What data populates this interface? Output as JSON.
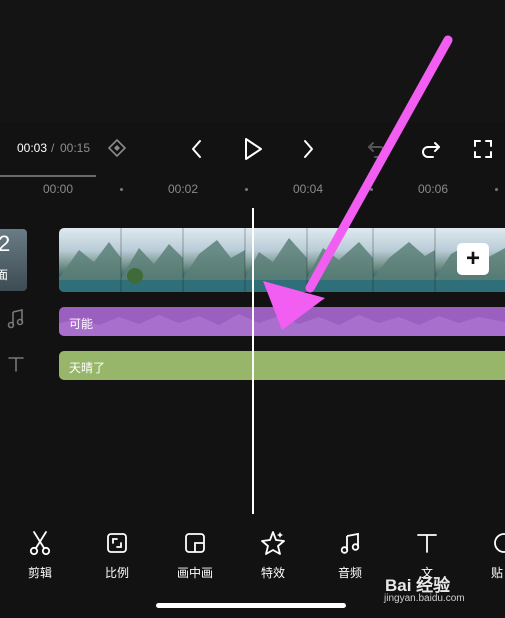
{
  "playback": {
    "current_time": "00:03",
    "separator": "/",
    "total_time": "00:15"
  },
  "ruler": {
    "ticks": [
      "00:00",
      "00:02",
      "00:04",
      "00:06"
    ]
  },
  "cover": {
    "number": "2",
    "label": "面"
  },
  "tracks": {
    "audio_label": "可能",
    "text_label": "天晴了"
  },
  "toolbar": {
    "items": [
      {
        "label": "剪辑",
        "icon": "scissors-icon"
      },
      {
        "label": "比例",
        "icon": "ratio-icon"
      },
      {
        "label": "画中画",
        "icon": "picture-in-picture-icon"
      },
      {
        "label": "特效",
        "icon": "effects-star-icon"
      },
      {
        "label": "音频",
        "icon": "music-note-icon"
      },
      {
        "label": "文",
        "icon": "text-icon"
      },
      {
        "label": "贴",
        "icon": "sticker-icon"
      }
    ]
  },
  "watermark": {
    "main": "Bai 经验",
    "sub": "jingyan.baidu.com"
  },
  "colors": {
    "background": "#121212",
    "audio_track": "#9b5fc0",
    "text_track": "#97b66a",
    "annotation_arrow": "#f25df2"
  }
}
